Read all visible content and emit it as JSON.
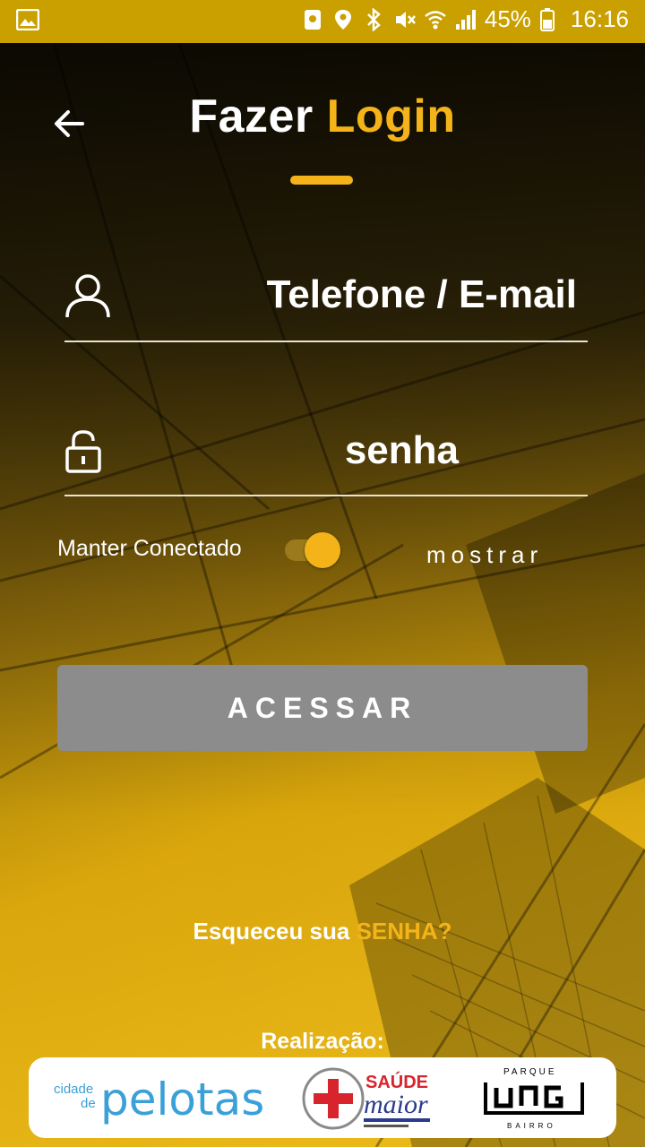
{
  "status_bar": {
    "battery": "45%",
    "time": "16:16",
    "icons": [
      "image-icon",
      "phone-locator-icon",
      "location-icon",
      "bluetooth-icon",
      "mute-icon",
      "wifi-icon",
      "signal-icon",
      "battery-icon"
    ]
  },
  "header": {
    "title_part1": "Fazer ",
    "title_part2": "Login",
    "back_icon": "back-arrow-icon"
  },
  "form": {
    "user_field": {
      "value": "Telefone / E-mail",
      "icon": "user-icon"
    },
    "password_field": {
      "value": "senha",
      "icon": "padlock-icon"
    },
    "keep_connected_label": "Manter Conectado",
    "keep_connected_on": true,
    "show_label": "mostrar",
    "submit_label": "ACESSAR"
  },
  "forgot": {
    "part1": "Esqueceu sua ",
    "part2": "SENHA?"
  },
  "footer": {
    "realizacao_label": "Realização:",
    "sponsors": [
      {
        "name": "cidade de pelotas",
        "text_small_1": "cidade",
        "text_small_2": "de",
        "text_main": "pelotas"
      },
      {
        "name": "saude maior",
        "text_1": "SAÚDE",
        "text_2": "maior"
      },
      {
        "name": "parque ung",
        "text_top": "PARQUE",
        "text_main": "UNG"
      }
    ]
  },
  "colors": {
    "accent": "#f4b419",
    "status_bar": "#c9a000",
    "button": "#8c8c8c",
    "pelotas_blue": "#3aa0d8",
    "saude_red": "#d8242c",
    "saude_blue": "#2a3a8c"
  }
}
